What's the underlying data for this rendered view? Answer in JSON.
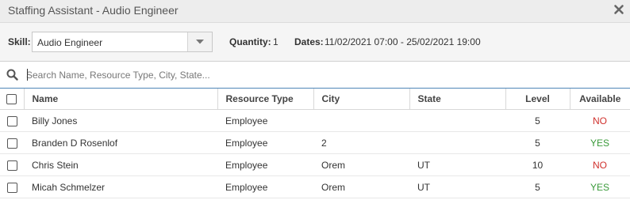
{
  "window": {
    "title": "Staffing Assistant - Audio Engineer"
  },
  "filters": {
    "skill_label": "Skill:",
    "skill_value": "Audio Engineer",
    "quantity_label": "Quantity:",
    "quantity_value": "1",
    "dates_label": "Dates:",
    "dates_value": "11/02/2021 07:00 - 25/02/2021 19:00"
  },
  "search": {
    "placeholder": "Search Name, Resource Type, City, State..."
  },
  "table": {
    "headers": {
      "name": "Name",
      "resource_type": "Resource Type",
      "city": "City",
      "state": "State",
      "level": "Level",
      "available": "Available"
    },
    "rows": [
      {
        "name": "Billy Jones",
        "resource_type": "Employee",
        "city": "",
        "state": "",
        "level": "5",
        "available": "NO"
      },
      {
        "name": "Branden D Rosenlof",
        "resource_type": "Employee",
        "city": "2",
        "state": "",
        "level": "5",
        "available": "YES"
      },
      {
        "name": "Chris Stein",
        "resource_type": "Employee",
        "city": "Orem",
        "state": "UT",
        "level": "10",
        "available": "NO"
      },
      {
        "name": "Micah Schmelzer",
        "resource_type": "Employee",
        "city": "Orem",
        "state": "UT",
        "level": "5",
        "available": "YES"
      }
    ]
  },
  "colors": {
    "available_no": "#d0312d",
    "available_yes": "#3a9a3a",
    "search_border": "#4f86b8"
  },
  "icons": {
    "close": "close-icon",
    "dropdown": "chevron-down-icon",
    "search": "search-icon"
  }
}
